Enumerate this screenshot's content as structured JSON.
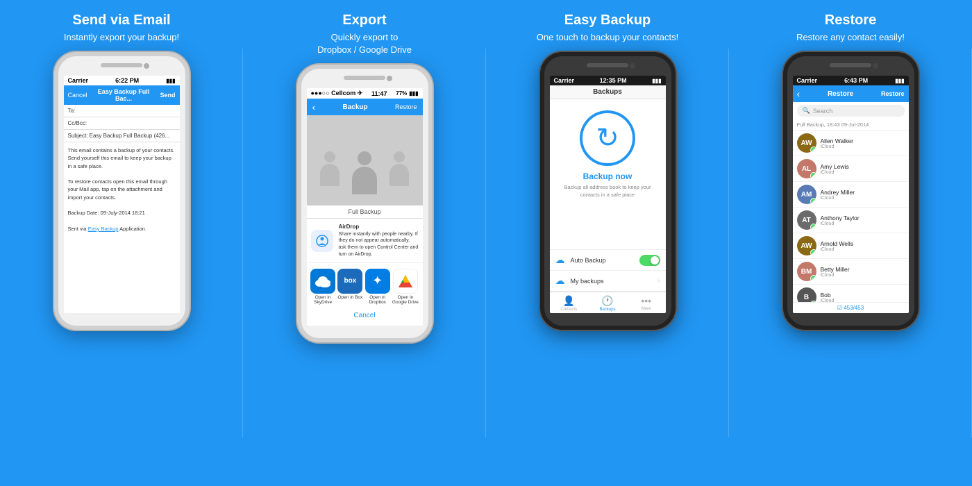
{
  "sections": [
    {
      "id": "email",
      "title": "Send via Email",
      "subtitle": "Instantly export your backup!",
      "phone_type": "white",
      "status": {
        "carrier": "Carrier",
        "wifi": true,
        "time": "6:22 PM",
        "battery": 100
      },
      "nav": {
        "cancel": "Cancel",
        "title": "Easy Backup Full Bac...",
        "send": "Send"
      },
      "fields": [
        {
          "label": "To:"
        },
        {
          "label": "Cc/Bcc:"
        },
        {
          "label": "Subject: Easy Backup Full Backup (426..."
        }
      ],
      "body_lines": [
        "This email contains a backup of your contacts.",
        "Send yourself this email to keep your backup in a safe place.",
        "",
        "To restore contacts open this email through your Mail app, tap on the attachment and import your contacts.",
        "",
        "Backup Date: 09-July-2014 18:21",
        "",
        "Sent via Easy Backup Application."
      ],
      "link_text": "Easy Backup"
    },
    {
      "id": "export",
      "title": "Export",
      "subtitle": "Quickly export to\nDropbox / Google Drive",
      "phone_type": "white",
      "status": {
        "carrier": "●●●○○ Cellcom",
        "wifi": true,
        "time": "11:47",
        "battery": 77,
        "battery_icon": "🔋"
      },
      "nav": {
        "back": "‹",
        "title": "Backup",
        "restore": "Restore"
      },
      "full_backup_label": "Full Backup",
      "airdrop": {
        "title": "AirDrop",
        "desc": "Share instantly with people nearby. If they do not appear automatically, ask them to open Control Center and turn on AirDrop."
      },
      "apps": [
        {
          "label": "Open in\nSkyDrive",
          "color": "#0078d7",
          "icon": "☁"
        },
        {
          "label": "Open in Box",
          "color": "#1c6bba",
          "icon": "box"
        },
        {
          "label": "Open in\nDropbox",
          "color": "#007ee5",
          "icon": "📦"
        },
        {
          "label": "Open in\nGoogle Drive",
          "color": "#f4b400",
          "icon": "▲"
        }
      ],
      "cancel_label": "Cancel"
    },
    {
      "id": "easy-backup",
      "title": "Easy Backup",
      "subtitle": "One touch to backup your contacts!",
      "phone_type": "dark",
      "status": {
        "carrier": "Carrier",
        "wifi": true,
        "time": "12:35 PM",
        "battery": 100
      },
      "nav_title": "Backups",
      "backup_now": "Backup now",
      "backup_desc": "Backup all address book to keep your contacts in a safe place",
      "options": [
        {
          "icon": "☁",
          "label": "Auto Backup",
          "control": "toggle"
        },
        {
          "icon": "☁",
          "label": "My backups",
          "control": "chevron"
        }
      ],
      "tabs": [
        {
          "icon": "👤",
          "label": "Contacts",
          "active": false
        },
        {
          "icon": "🕐",
          "label": "Backups",
          "active": true
        },
        {
          "icon": "●●●",
          "label": "More",
          "active": false
        }
      ]
    },
    {
      "id": "restore",
      "title": "Restore",
      "subtitle": "Restore any contact easily!",
      "phone_type": "dark",
      "status": {
        "carrier": "Carrier",
        "wifi": true,
        "time": "6:43 PM",
        "battery": 100
      },
      "nav": {
        "back": "‹",
        "title": "Restore",
        "btn": "Restore"
      },
      "search_placeholder": "Search",
      "backup_date": "Full Backup, 18:43 09-Jul-2014",
      "contacts": [
        {
          "name": "Allen Walker",
          "source": "iCloud",
          "color": "#8B6914"
        },
        {
          "name": "Amy Lewis",
          "source": "iCloud",
          "color": "#C4786A"
        },
        {
          "name": "Andrey Miller",
          "source": "iCloud",
          "color": "#5a7ab5"
        },
        {
          "name": "Anthony Taylor",
          "source": "iCloud",
          "color": "#6b6b6b"
        },
        {
          "name": "Arnold Wells",
          "source": "iCloud",
          "color": "#8B6914"
        },
        {
          "name": "Betty Miller",
          "source": "iCloud",
          "color": "#C4786A"
        },
        {
          "name": "Bob",
          "source": "iCloud",
          "color": "#555"
        }
      ],
      "count_label": "453/453"
    }
  ]
}
